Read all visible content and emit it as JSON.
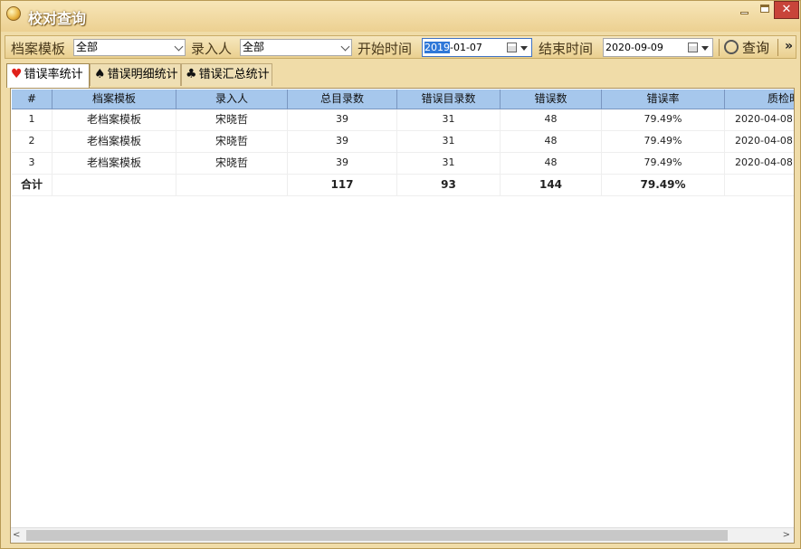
{
  "window": {
    "title": "校对查询"
  },
  "toolbar": {
    "template_label": "档案模板",
    "template_value": "全部",
    "enterer_label": "录入人",
    "enterer_value": "全部",
    "start_label": "开始时间",
    "start_value_sel": "2019",
    "start_value_rest": "-01-07",
    "end_label": "结束时间",
    "end_value": "2020-09-09",
    "query_label": "查询",
    "more_glyph": "»"
  },
  "tabs": [
    {
      "label": "错误率统计",
      "suit": "♥"
    },
    {
      "label": "错误明细统计",
      "suit": "♠"
    },
    {
      "label": "错误汇总统计",
      "suit": "♣"
    }
  ],
  "table": {
    "headers": [
      "#",
      "档案模板",
      "录入人",
      "总目录数",
      "错误目录数",
      "错误数",
      "错误率",
      "质检时"
    ],
    "rows": [
      [
        "1",
        "老档案模板",
        "宋晓哲",
        "39",
        "31",
        "48",
        "79.49%",
        "2020-04-08"
      ],
      [
        "2",
        "老档案模板",
        "宋晓哲",
        "39",
        "31",
        "48",
        "79.49%",
        "2020-04-08"
      ],
      [
        "3",
        "老档案模板",
        "宋晓哲",
        "39",
        "31",
        "48",
        "79.49%",
        "2020-04-08"
      ]
    ],
    "total": [
      "合计",
      "",
      "",
      "117",
      "93",
      "144",
      "79.49%",
      ""
    ]
  }
}
